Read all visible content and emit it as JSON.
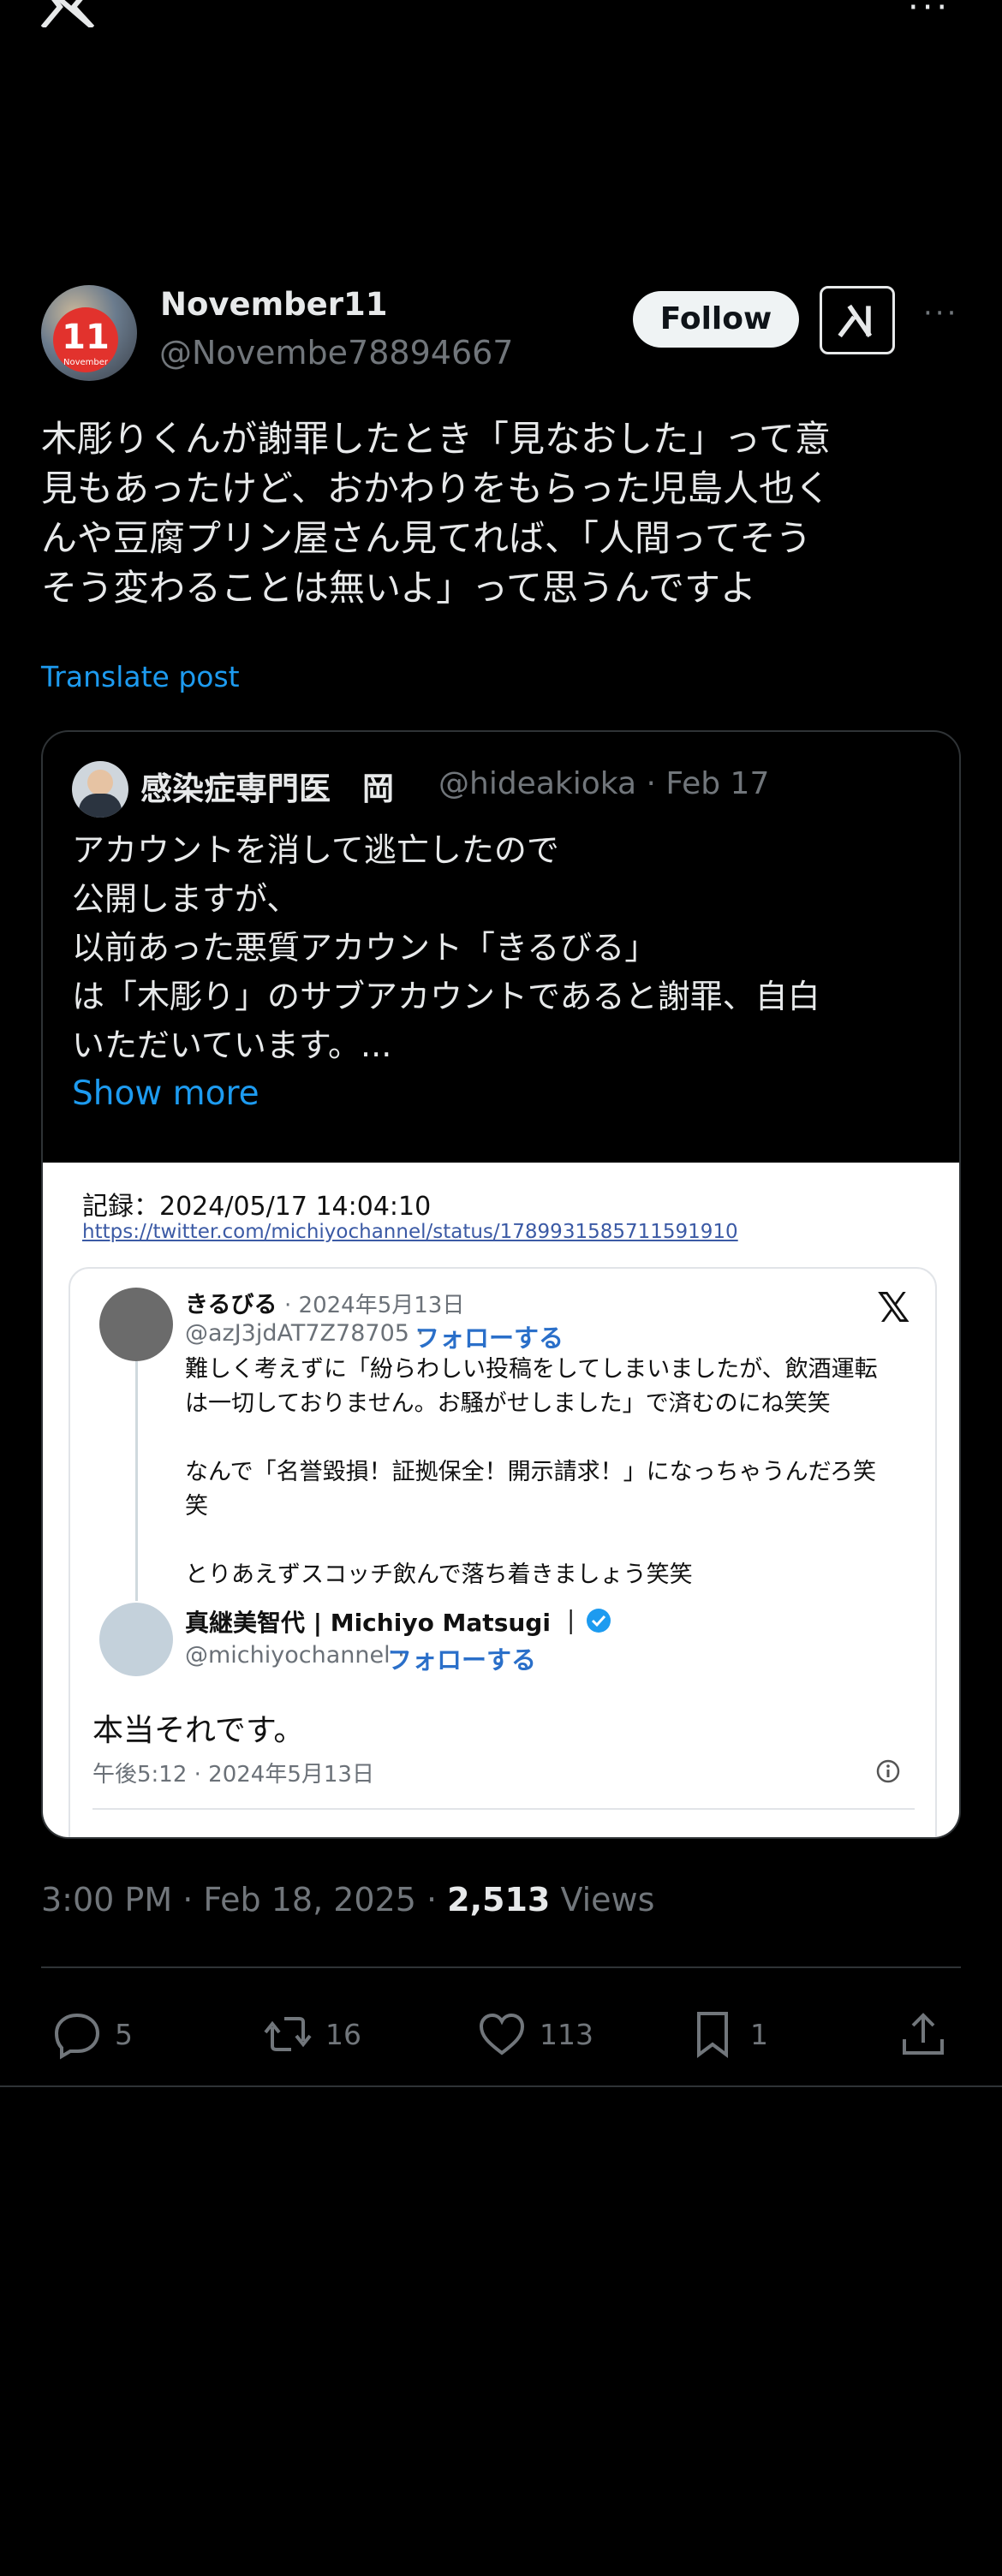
{
  "author": {
    "display_name": "November11",
    "handle": "@Novembe78894667",
    "avatar_badge": "11",
    "avatar_badge_sub": "November"
  },
  "follow_label": "Follow",
  "post": {
    "text": "木彫りくんが謝罪したとき「見なおした」って意\n見もあったけど、おかわりをもらった児島人也く\nんや豆腐プリン屋さん見てれば、「人間ってそう\nそう変わることは無いよ」って思うんですよ",
    "translate_label": "Translate post"
  },
  "quote": {
    "name": "感染症専門医　岡",
    "meta": "@hideakioka · Feb 17",
    "text": "アカウントを消して逃亡したので\n公開しますが、\n以前あった悪質アカウント「きるびる」\nは「木彫り」のサブアカウントであると謝罪、自白\nいただいています。...",
    "show_more": "Show more",
    "screenshot": {
      "record": "記録：2024/05/17 14:04:10",
      "url": "https://twitter.com/michiyochannel/status/1789931585711591910",
      "tweet1": {
        "name": "きるびる",
        "date": "· 2024年5月13日",
        "handle": "@azJ3jdAT7Z78705 ·",
        "follow": "フォローする",
        "body": "難しく考えずに「紛らわしい投稿をしてしまいましたが、飲酒運転\nは一切しておりません。お騒がせしました」で済むのにね笑笑\n\nなんで「名誉毀損！証拠保全！開示請求！」になっちゃうんだろ笑\n笑\n\nとりあえずスコッチ飲んで落ち着きましょう笑笑"
      },
      "tweet2": {
        "name": "真継美智代 | Michiyo Matsugi ｜",
        "handle": "@michiyochannel ·",
        "follow": "フォローする",
        "reply": "本当それです。",
        "time": "午後5:12 · 2024年5月13日"
      }
    }
  },
  "stats": {
    "time": "3:00 PM · Feb 18, 2025 · ",
    "views_count": "2,513",
    "views_label": " Views"
  },
  "actions": {
    "replies": "5",
    "reposts": "16",
    "likes": "113",
    "bookmarks": "1"
  },
  "colors": {
    "background": "#000000",
    "text": "#e7e9ea",
    "muted": "#71767b",
    "link": "#1d9bf0",
    "border": "#2f3336"
  }
}
